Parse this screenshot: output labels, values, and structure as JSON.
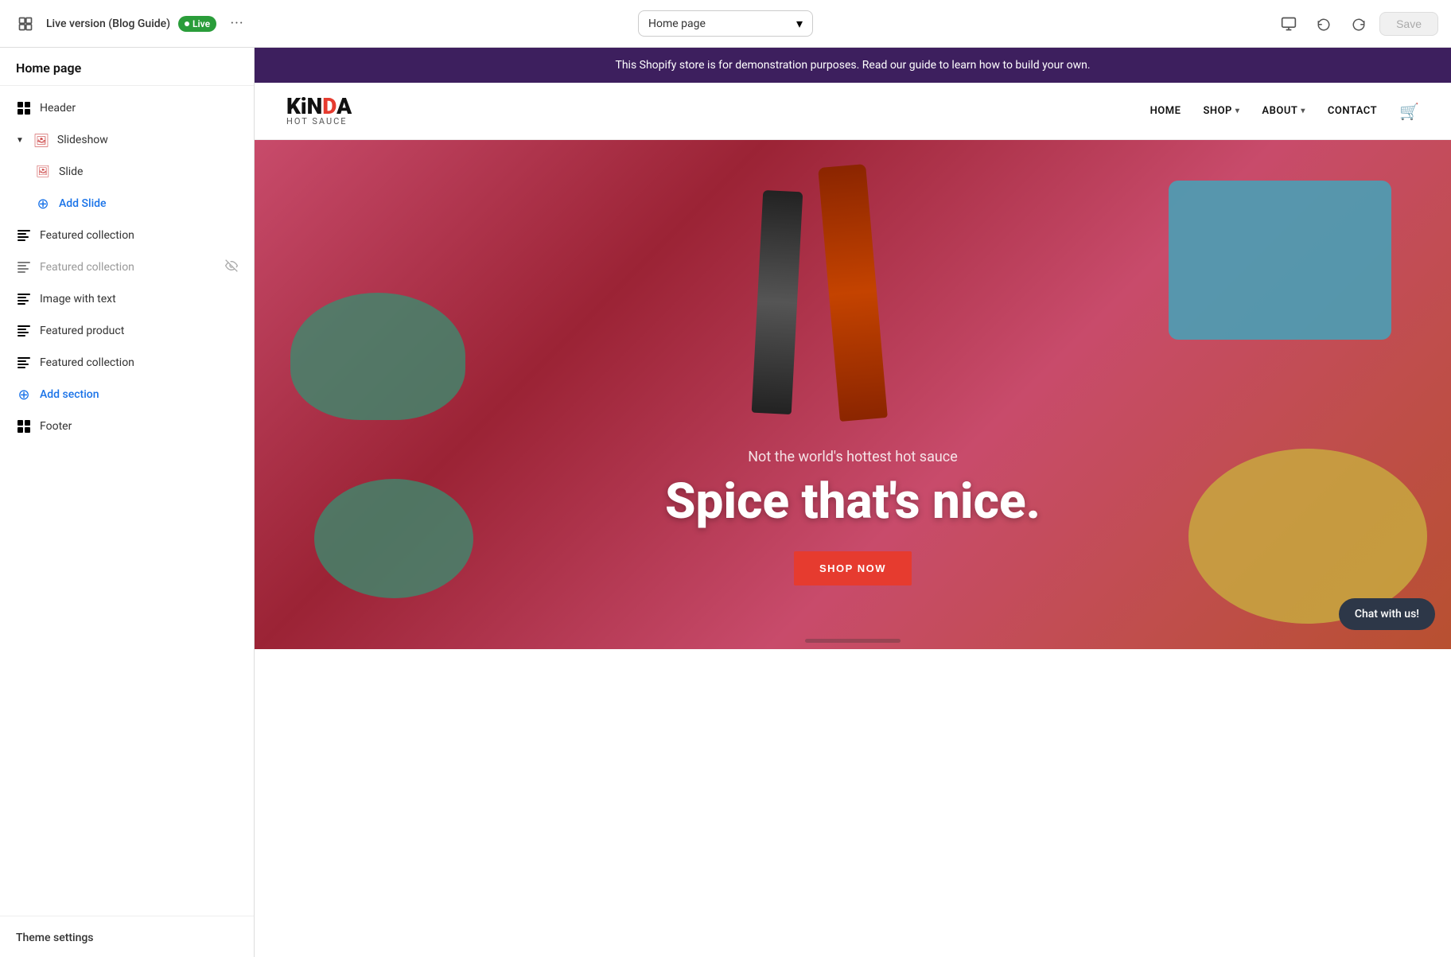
{
  "topbar": {
    "version_label": "Live version (Blog Guide)",
    "live_badge": "Live",
    "more_button": "···",
    "page_select_label": "Home page",
    "save_button": "Save",
    "desktop_icon": "desktop",
    "undo_icon": "undo",
    "redo_icon": "redo"
  },
  "sidebar": {
    "title": "Home page",
    "items": [
      {
        "id": "header",
        "label": "Header",
        "icon": "grid",
        "indent": 0
      },
      {
        "id": "slideshow",
        "label": "Slideshow",
        "icon": "image",
        "indent": 0,
        "collapsed": false
      },
      {
        "id": "slide",
        "label": "Slide",
        "icon": "image-small",
        "indent": 1
      },
      {
        "id": "add-slide",
        "label": "Add Slide",
        "icon": "plus",
        "indent": 1,
        "is_add": true
      },
      {
        "id": "featured-collection-1",
        "label": "Featured collection",
        "icon": "bars",
        "indent": 0
      },
      {
        "id": "featured-collection-2",
        "label": "Featured collection",
        "icon": "bars",
        "indent": 0,
        "hidden": true
      },
      {
        "id": "image-with-text",
        "label": "Image with text",
        "icon": "bars",
        "indent": 0
      },
      {
        "id": "featured-product",
        "label": "Featured product",
        "icon": "bars",
        "indent": 0
      },
      {
        "id": "featured-collection-3",
        "label": "Featured collection",
        "icon": "bars",
        "indent": 0
      },
      {
        "id": "add-section",
        "label": "Add section",
        "icon": "plus",
        "indent": 0,
        "is_add": true
      },
      {
        "id": "footer",
        "label": "Footer",
        "icon": "grid",
        "indent": 0
      }
    ],
    "theme_settings": "Theme settings"
  },
  "preview": {
    "announcement": "This Shopify store is for demonstration purposes. Read our guide to learn how to build your own.",
    "logo_line1": "KiNDA",
    "logo_line2": "HOT SAUCE",
    "nav_links": [
      {
        "label": "HOME",
        "has_caret": false
      },
      {
        "label": "SHOP",
        "has_caret": true
      },
      {
        "label": "ABOUT",
        "has_caret": true
      },
      {
        "label": "CONTACT",
        "has_caret": false
      }
    ],
    "hero_subtitle": "Not the world's hottest hot sauce",
    "hero_title": "Spice that's nice.",
    "hero_cta": "SHOP NOW",
    "chat_label": "Chat with us!"
  }
}
